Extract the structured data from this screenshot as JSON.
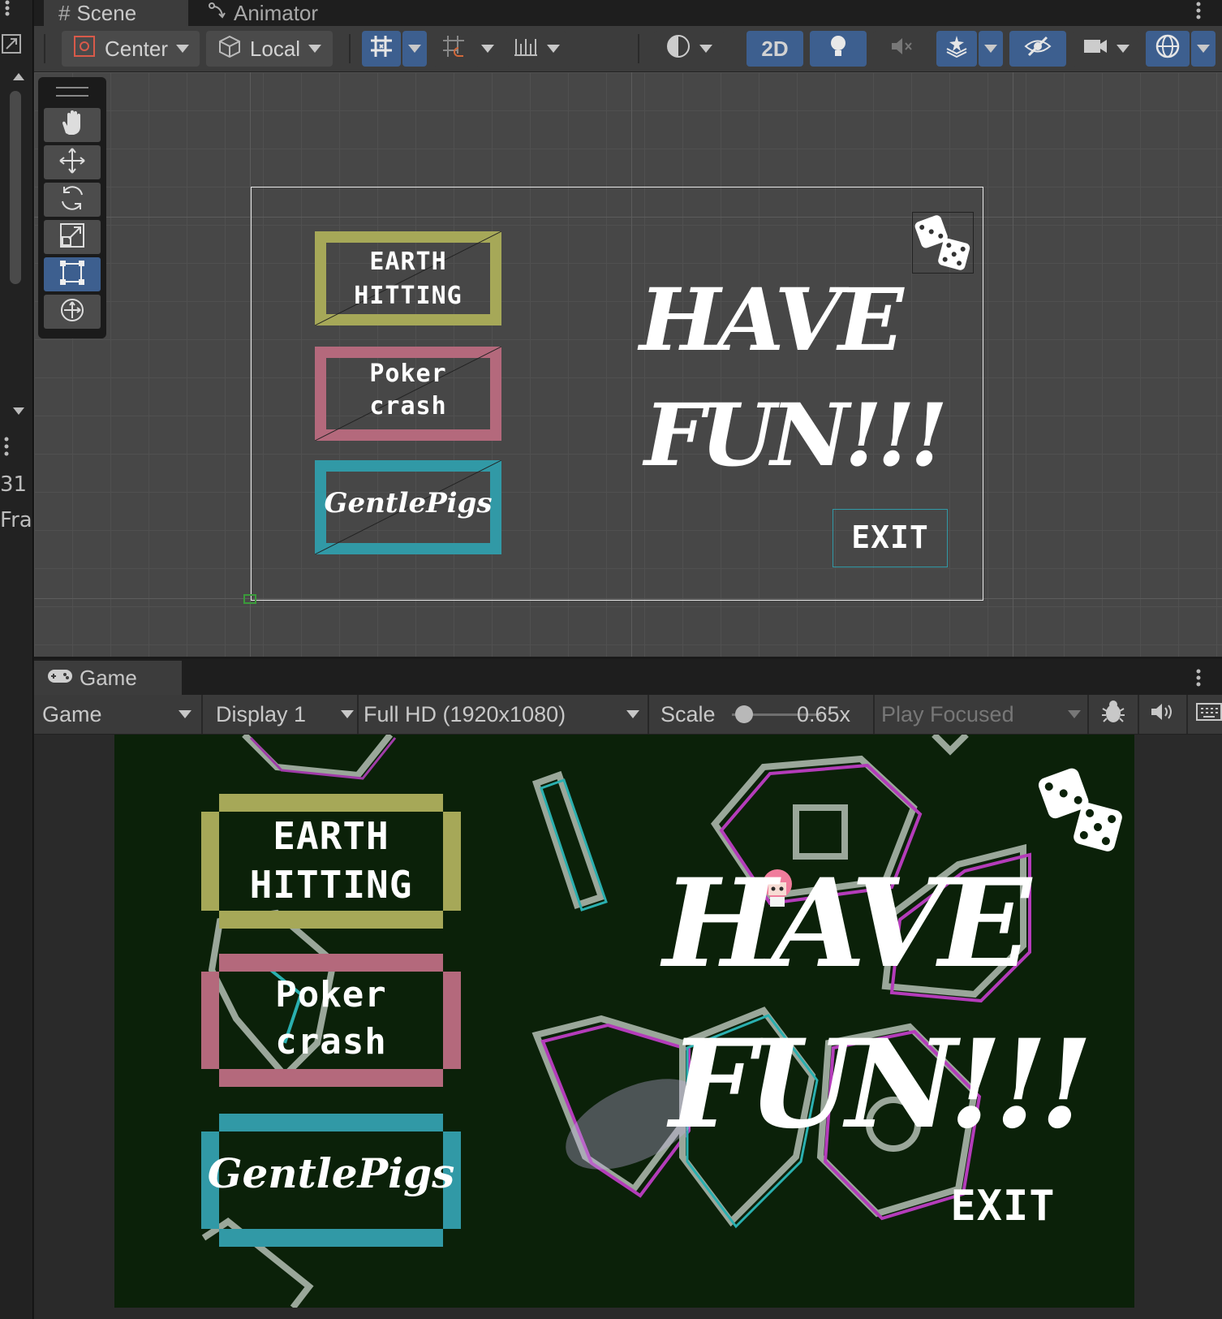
{
  "left_strip": {
    "line1": "31",
    "line2": "Fra"
  },
  "scene": {
    "tabs": [
      {
        "label": "Scene",
        "icon": "hash-icon"
      },
      {
        "label": "Animator",
        "icon": "animator-icon"
      }
    ],
    "toolbar": {
      "pivot_label": "Center",
      "space_label": "Local",
      "mode_2d_label": "2D"
    },
    "tools": [
      "hand-tool",
      "move-tool",
      "rotate-tool",
      "scale-tool",
      "rect-tool",
      "transform-tool"
    ]
  },
  "ui_content": {
    "button1_line1": "EARTH",
    "button1_line2": "HITTING",
    "button2_line1": "Poker",
    "button2_line2": "crash",
    "button3_label": "GentlePigs",
    "headline_line1": "HAVE",
    "headline_line2": "FUN!!!",
    "exit_label": "EXIT"
  },
  "colors": {
    "button1": "#a6a858",
    "button2": "#b4697c",
    "button3": "#3199a6",
    "game_bg": "#0b2109",
    "selected_tool": "#3d5f8f"
  },
  "game": {
    "tab_label": "Game",
    "view_label": "Game",
    "display_label": "Display 1",
    "resolution_label": "Full HD (1920x1080)",
    "scale_label": "Scale",
    "scale_value": "0.65x",
    "scale_slider_level": 0.05,
    "play_mode_label": "Play Focused"
  }
}
